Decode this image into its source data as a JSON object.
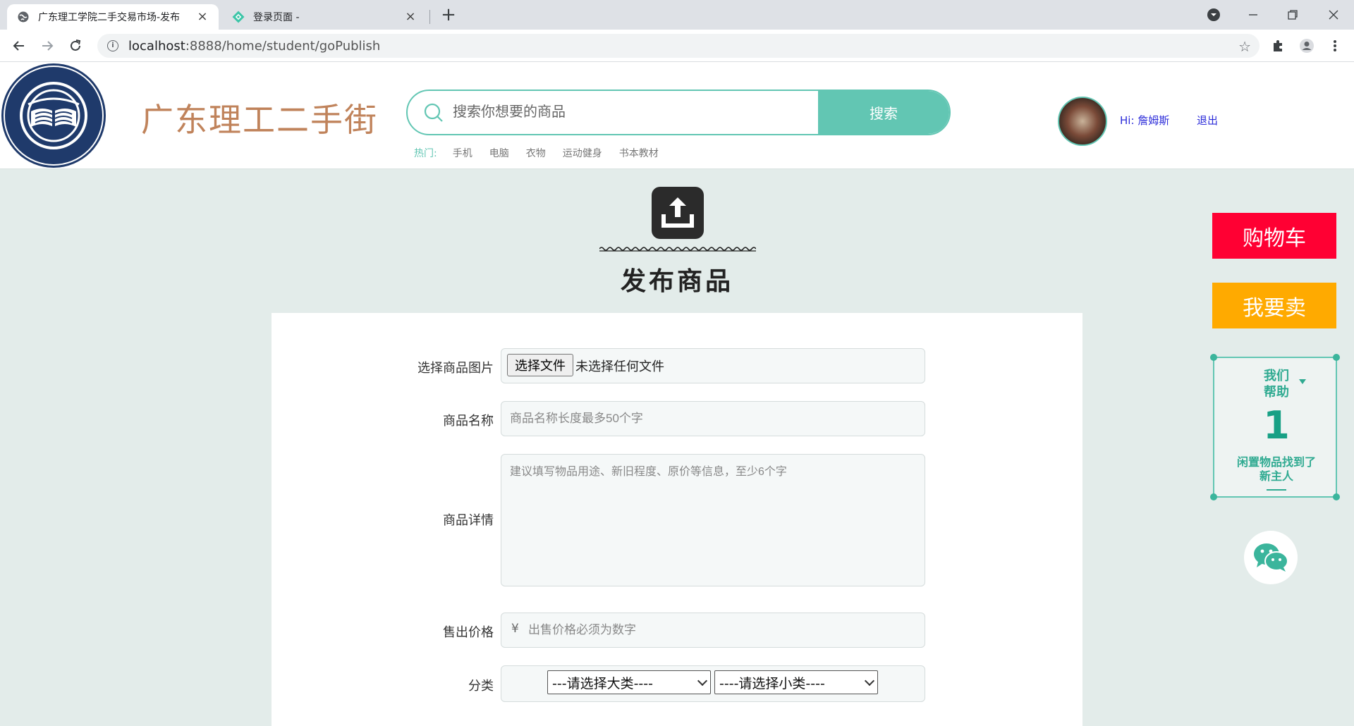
{
  "browser": {
    "tabs": [
      {
        "title": "广东理工学院二手交易市场-发布",
        "active": true
      },
      {
        "title": "登录页面 -",
        "active": false
      }
    ],
    "url_host": "localhost",
    "url_path": ":8888/home/student/goPublish"
  },
  "header": {
    "brand": "广东理工二手街",
    "search_placeholder": "搜索你想要的商品",
    "search_button": "搜索",
    "hot_label": "热门:",
    "hot_items": [
      "手机",
      "电脑",
      "衣物",
      "运动健身",
      "书本教材"
    ],
    "greeting": "Hi: 詹姆斯",
    "logout": "退出"
  },
  "float": {
    "cart": "购物车",
    "sell": "我要卖",
    "stat_title": "我们\n帮助",
    "stat_number": "1",
    "stat_desc": "闲置物品找到了\n新主人"
  },
  "publish": {
    "title": "发布商品"
  },
  "form": {
    "image_label": "选择商品图片",
    "file_button": "选择文件",
    "file_status": "未选择任何文件",
    "name_label": "商品名称",
    "name_placeholder": "商品名称长度最多50个字",
    "detail_label": "商品详情",
    "detail_placeholder": "建议填写物品用途、新旧程度、原价等信息，至少6个字",
    "price_label": "售出价格",
    "price_symbol": "¥",
    "price_placeholder": "出售价格必须为数字",
    "category_label": "分类",
    "category_main": "---请选择大类----",
    "category_sub": "----请选择小类----"
  },
  "colors": {
    "accent": "#62c6b3",
    "cart": "#ff0033",
    "sell": "#ffaa00",
    "brand": "#c0835b"
  }
}
